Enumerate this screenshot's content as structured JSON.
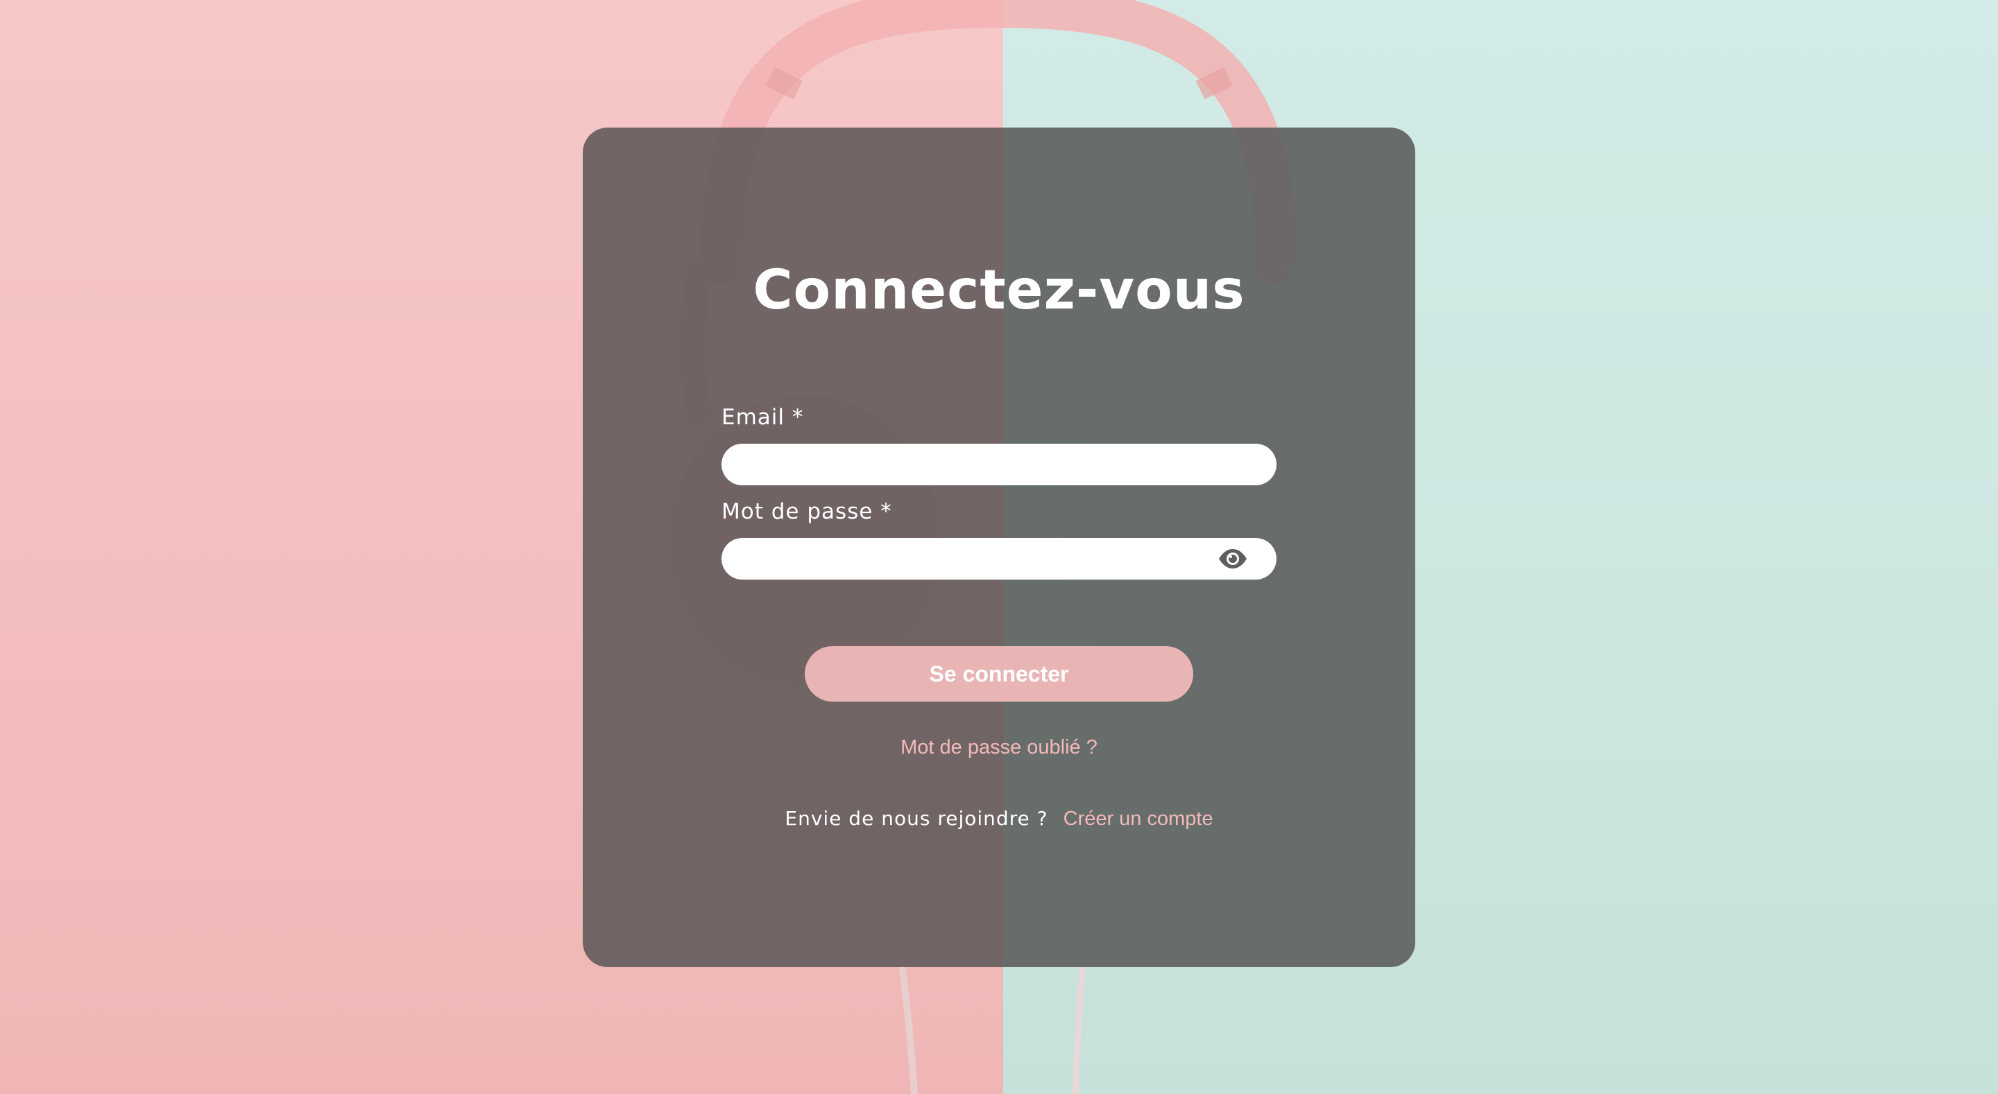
{
  "login": {
    "title": "Connectez-vous",
    "email_label": "Email *",
    "email_value": "",
    "password_label": "Mot de passe *",
    "password_value": "",
    "password_toggle_icon": "eye-icon",
    "submit_label": "Se connecter",
    "forgot_link": "Mot de passe oublié ?",
    "signup_prompt": "Envie de nous rejoindre ?",
    "signup_link": "Créer un compte"
  },
  "colors": {
    "background_left": "#f6c8c8",
    "background_right": "#d3ebe6",
    "card_overlay": "#5f5858",
    "button": "#e9b4b4",
    "link": "#f3b9b9",
    "text": "#ffffff"
  }
}
